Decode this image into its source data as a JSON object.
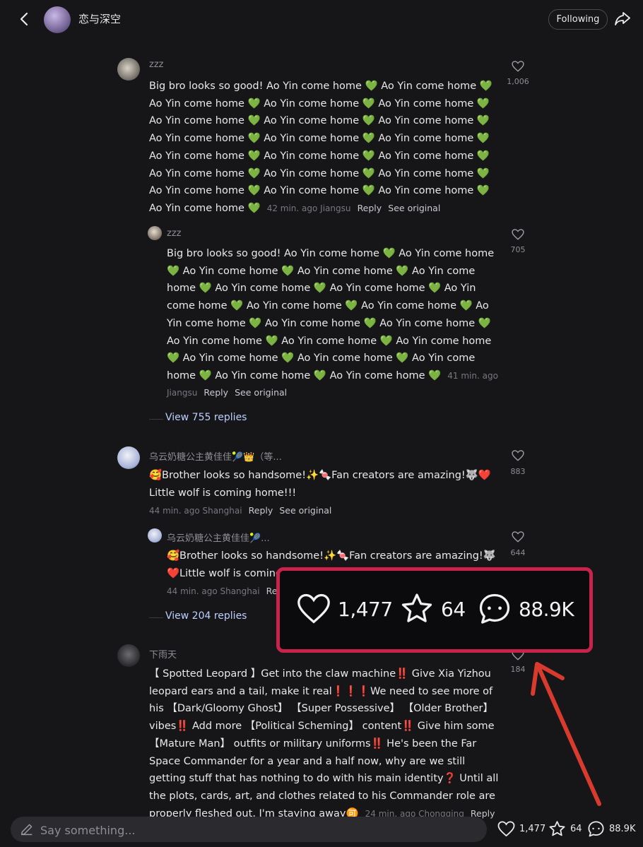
{
  "header": {
    "title": "恋与深空",
    "follow_label": "Following"
  },
  "comments": [
    {
      "user": "zzz",
      "text": "Big bro looks so good! Ao Yin come home 💚 Ao Yin come home 💚 Ao Yin come home 💚 Ao Yin come home 💚 Ao Yin come home 💚 Ao Yin come home 💚 Ao Yin come home 💚 Ao Yin come home 💚 Ao Yin come home 💚 Ao Yin come home 💚 Ao Yin come home 💚 Ao Yin come home 💚 Ao Yin come home 💚 Ao Yin come home 💚 Ao Yin come home 💚 Ao Yin come home 💚 Ao Yin come home 💚 Ao Yin come home 💚 Ao Yin come home 💚 Ao Yin come home 💚 Ao Yin come home 💚",
      "meta": "42 min. ago Jiangsu",
      "reply": "Reply",
      "see_original": "See original",
      "likes": "1,006"
    },
    {
      "user": "zzz",
      "text": "Big bro looks so good! Ao Yin come home 💚 Ao Yin come home 💚 Ao Yin come home 💚 Ao Yin come home 💚 Ao Yin come home 💚 Ao Yin come home 💚 Ao Yin come home 💚 Ao Yin come home 💚 Ao Yin come home 💚 Ao Yin come home 💚 Ao Yin come home 💚 Ao Yin come home 💚 Ao Yin come home 💚 Ao Yin come home 💚 Ao Yin come home 💚 Ao Yin come home 💚 Ao Yin come home 💚 Ao Yin come home 💚 Ao Yin come home 💚 Ao Yin come home 💚 Ao Yin come home 💚",
      "meta": "41 min. ago Jiangsu",
      "reply": "Reply",
      "see_original": "See original",
      "likes": "705"
    },
    {
      "user": "乌云奶糖公主黄佳佳🎾👑（等...",
      "text": "🥰Brother looks so handsome!✨🍬Fan creators are amazing!🐺❤️Little wolf is coming home!!!",
      "meta": "44 min. ago Shanghai",
      "reply": "Reply",
      "see_original": "See original",
      "likes": "883"
    },
    {
      "user": "乌云奶糖公主黄佳佳🎾...",
      "text": "🥰Brother looks so handsome!✨🍬Fan creators are amazing!🐺❤️Little wolf is coming home!!!",
      "meta": "44 min. ago Shanghai",
      "reply": "Reply",
      "likes": "644"
    },
    {
      "user": "下雨天",
      "text": "【 Spotted Leopard 】Get into the claw machine‼️ Give Xia Yizhou leopard ears and a tail, make it real❗❗❗We need to see more of his 【Dark/Gloomy Ghost】 【Super Possessive】 【Older Brother】 vibes‼️ Add more 【Political Scheming】 content‼️ Give him some 【Mature Man】 outfits or military uniforms‼️ He's been the Far Space Commander for a year and a half now, why are we still getting stuff that has nothing to do with his main identity❓ Until all the plots, cards, art, and clothes related to his Commander role are properly fleshed out, I'm staying away🉑",
      "meta": "24 min. ago Chongqing",
      "reply": "Reply",
      "likes": "184"
    }
  ],
  "view_replies": [
    "View 755 replies",
    "View 204 replies"
  ],
  "overlay": {
    "likes": "1,477",
    "stars": "64",
    "comments": "88.9K"
  },
  "bottom_bar": {
    "placeholder": "Say something...",
    "likes": "1,477",
    "stars": "64",
    "comments": "88.9K"
  },
  "colors": {
    "background": "#161619",
    "highlight_border": "#c9224d",
    "arrow": "#d93a2e",
    "link": "#bdd0ff"
  }
}
